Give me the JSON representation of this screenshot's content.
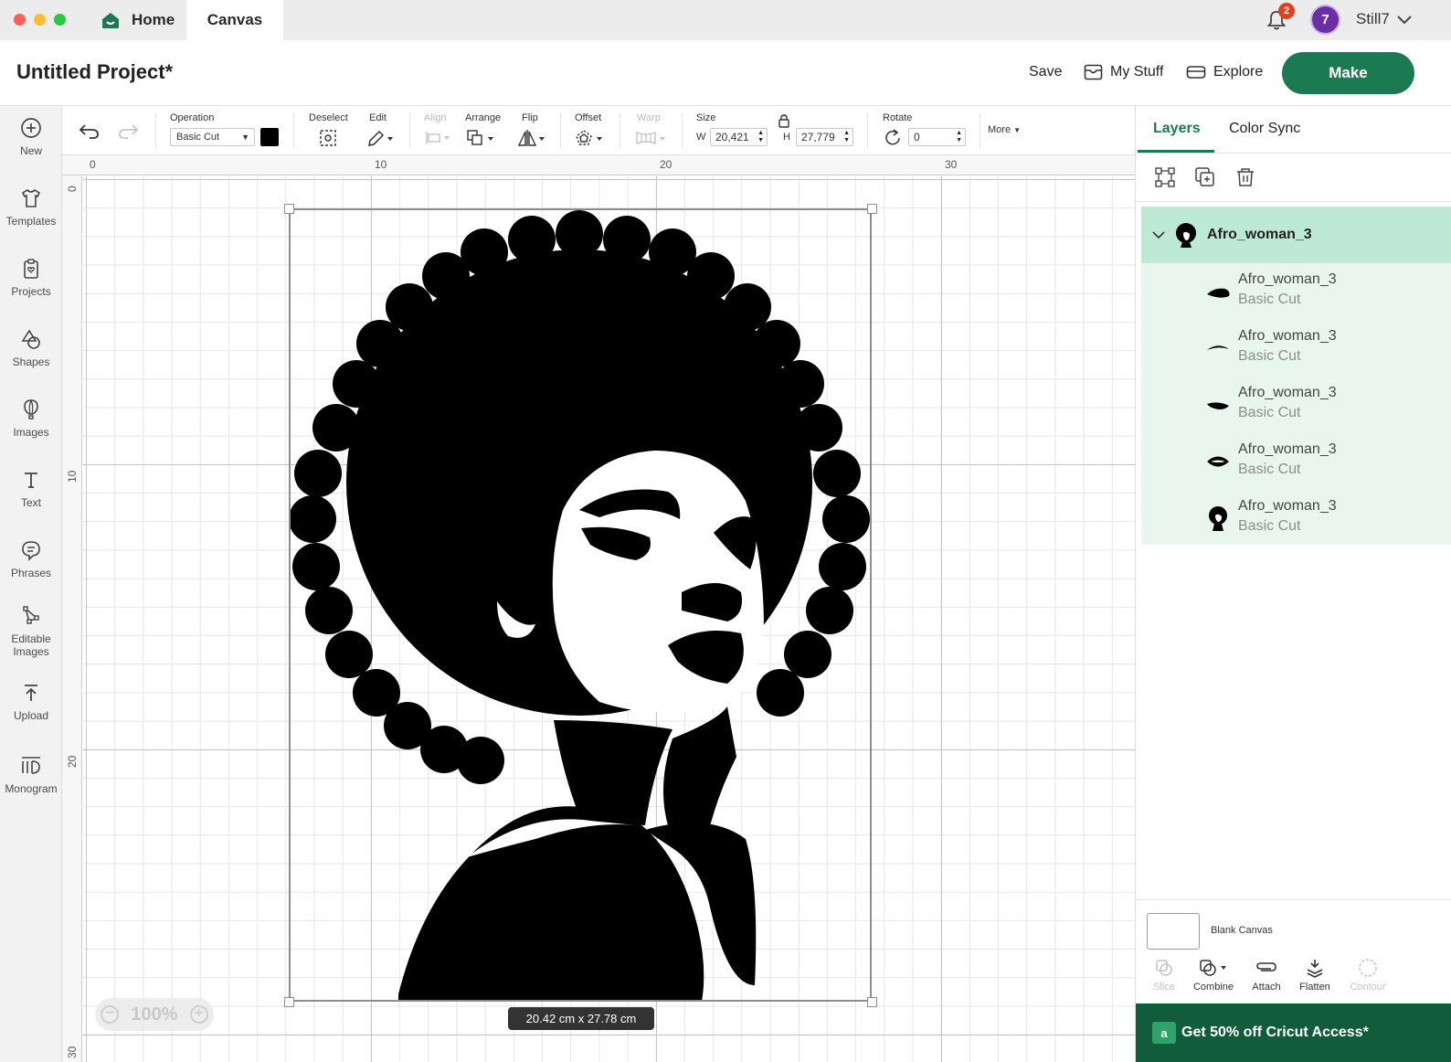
{
  "titlebar": {
    "home_tab": "Home",
    "canvas_tab": "Canvas",
    "notification_count": "2",
    "username": "Still7",
    "avatar_initials": "7"
  },
  "header": {
    "project_title": "Untitled Project*",
    "save": "Save",
    "my_stuff": "My Stuff",
    "explore": "Explore",
    "make": "Make"
  },
  "sidebar": {
    "items": [
      {
        "label": "New",
        "icon": "plus-circle-icon"
      },
      {
        "label": "Templates",
        "icon": "shirt-icon"
      },
      {
        "label": "Projects",
        "icon": "clipboard-icon"
      },
      {
        "label": "Shapes",
        "icon": "shapes-icon"
      },
      {
        "label": "Images",
        "icon": "balloon-icon"
      },
      {
        "label": "Text",
        "icon": "text-icon"
      },
      {
        "label": "Phrases",
        "icon": "speech-bubble-icon"
      },
      {
        "label": "Editable Images",
        "icon": "editable-image-icon"
      },
      {
        "label": "Upload",
        "icon": "upload-icon"
      },
      {
        "label": "Monogram",
        "icon": "monogram-icon"
      }
    ]
  },
  "toolbar": {
    "operation_label": "Operation",
    "operation_value": "Basic Cut",
    "deselect_label": "Deselect",
    "edit_label": "Edit",
    "align_label": "Align",
    "arrange_label": "Arrange",
    "flip_label": "Flip",
    "offset_label": "Offset",
    "warp_label": "Warp",
    "size_label": "Size",
    "width_prefix": "W",
    "width_value": "20,421",
    "height_prefix": "H",
    "height_value": "27,779",
    "rotate_label": "Rotate",
    "rotate_value": "0",
    "more_label": "More"
  },
  "canvas": {
    "ruler_top": [
      "0",
      "10",
      "20",
      "30"
    ],
    "ruler_left": [
      "0",
      "10",
      "20",
      "30"
    ],
    "size_tooltip": "20.42  cm x 27.78  cm",
    "zoom_level": "100%"
  },
  "panel": {
    "tabs": [
      "Layers",
      "Color Sync"
    ],
    "group_name": "Afro_woman_3",
    "layers": [
      {
        "name": "Afro_woman_3",
        "operation": "Basic Cut"
      },
      {
        "name": "Afro_woman_3",
        "operation": "Basic Cut"
      },
      {
        "name": "Afro_woman_3",
        "operation": "Basic Cut"
      },
      {
        "name": "Afro_woman_3",
        "operation": "Basic Cut"
      },
      {
        "name": "Afro_woman_3",
        "operation": "Basic Cut"
      }
    ],
    "blank_canvas": "Blank Canvas",
    "bottom_tools": [
      "Slice",
      "Combine",
      "Attach",
      "Flatten",
      "Contour"
    ],
    "promo": "Get 50% off Cricut Access*"
  },
  "colors": {
    "brand_green": "#1b7a52",
    "selected_layer": "#bfe9d7",
    "layer_children": "#e8f6ef",
    "promo_bg": "#115c3b",
    "notification_badge": "#e1401f"
  }
}
